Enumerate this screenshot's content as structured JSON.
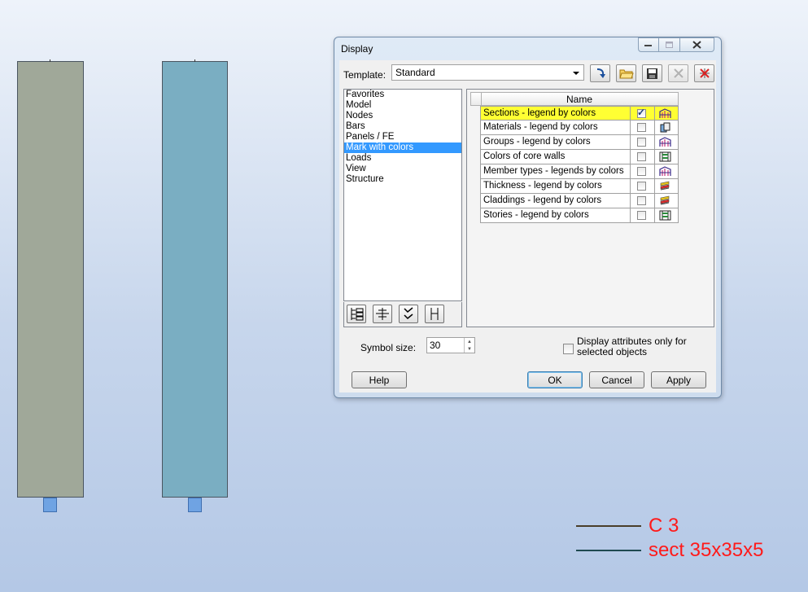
{
  "viewport": {
    "legend": [
      {
        "text": "C 3",
        "line_color": "#4a3e2a"
      },
      {
        "text": "sect 35x35x5",
        "line_color": "#1e4a50"
      }
    ],
    "legend_text_color": "#ff1a1a"
  },
  "dialog": {
    "title": "Display",
    "template_label": "Template:",
    "template_value": "Standard",
    "toolbar_icons": [
      "apply-template-icon",
      "open-folder-icon",
      "save-icon",
      "delete-icon",
      "reset-icon"
    ],
    "categories": [
      "Favorites",
      "Model",
      "Nodes",
      "Bars",
      "Panels / FE",
      "Mark with colors",
      "Loads",
      "View",
      "Structure"
    ],
    "selected_category": "Mark with colors",
    "column_header": "Name",
    "rows": [
      {
        "label": "Sections - legend by colors",
        "checked": true,
        "highlighted": true,
        "icon": "sections-colors-icon"
      },
      {
        "label": "Materials - legend by colors",
        "checked": false,
        "icon": "materials-colors-icon"
      },
      {
        "label": "Groups - legend by colors",
        "checked": false,
        "icon": "groups-colors-icon"
      },
      {
        "label": "Colors of core walls",
        "checked": false,
        "icon": "core-walls-colors-icon"
      },
      {
        "label": "Member types - legends by colors",
        "checked": false,
        "icon": "member-types-colors-icon"
      },
      {
        "label": "Thickness - legend by colors",
        "checked": false,
        "icon": "thickness-colors-icon"
      },
      {
        "label": "Claddings - legend by colors",
        "checked": false,
        "icon": "claddings-colors-icon"
      },
      {
        "label": "Stories - legend by colors",
        "checked": false,
        "icon": "stories-colors-icon"
      }
    ],
    "symbol_size_label": "Symbol size:",
    "symbol_size_value": "30",
    "attributes_label": "Display attributes only for selected objects",
    "attributes_checked": false,
    "buttons": {
      "help": "Help",
      "ok": "OK",
      "cancel": "Cancel",
      "apply": "Apply"
    },
    "highlight_color": "#ffff33",
    "selection_color": "#3399ff"
  }
}
